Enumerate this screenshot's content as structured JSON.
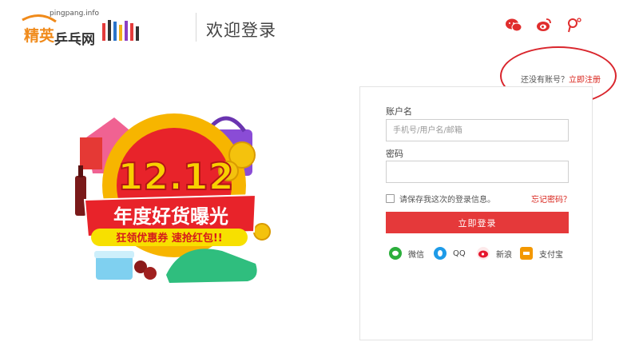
{
  "header": {
    "logo_url_text": "pingpang.info",
    "logo_text_1": "精英",
    "logo_text_2": "乒乓网",
    "page_title": "欢迎登录",
    "icons": [
      "wechat-icon",
      "weibo-icon",
      "ping-icon"
    ]
  },
  "register": {
    "prompt": "还没有账号？",
    "link": "立即注册"
  },
  "promo": {
    "big_number": "12.12",
    "headline": "年度好货曝光",
    "subline": "狂领优惠券 速抢红包!!"
  },
  "login_form": {
    "account_label": "账户名",
    "account_placeholder": "手机号/用户名/邮箱",
    "password_label": "密码",
    "remember_text": "请保存我这次的登录信息。",
    "forgot_link": "忘记密码？",
    "login_button": "立即登录"
  },
  "third_party": [
    {
      "name": "微信",
      "icon": "wechat-icon",
      "color": "#2bae3b"
    },
    {
      "name": "QQ",
      "icon": "qq-icon",
      "color": "#1e9be8"
    },
    {
      "name": "新浪",
      "icon": "sina-icon",
      "color": "#e6162d"
    },
    {
      "name": "支付宝",
      "icon": "alipay-icon",
      "color": "#f39800"
    }
  ],
  "colors": {
    "accent": "#e5393a",
    "link": "#d9251d"
  }
}
